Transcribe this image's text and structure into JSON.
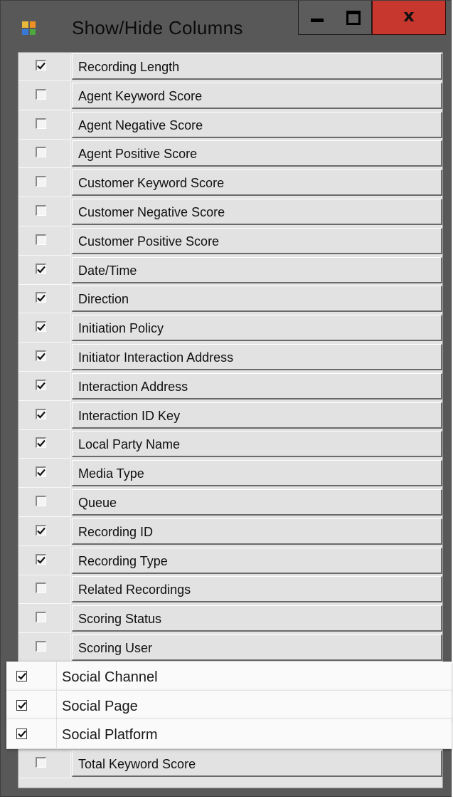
{
  "window": {
    "title": "Show/Hide Columns",
    "icon": "app-window-icon",
    "close_label": "x"
  },
  "columns": [
    {
      "label": "Recording Length",
      "checked": true
    },
    {
      "label": "Agent Keyword Score",
      "checked": false
    },
    {
      "label": "Agent Negative Score",
      "checked": false
    },
    {
      "label": "Agent Positive Score",
      "checked": false
    },
    {
      "label": "Customer Keyword Score",
      "checked": false
    },
    {
      "label": "Customer Negative Score",
      "checked": false
    },
    {
      "label": "Customer Positive Score",
      "checked": false
    },
    {
      "label": "Date/Time",
      "checked": true
    },
    {
      "label": "Direction",
      "checked": true
    },
    {
      "label": "Initiation Policy",
      "checked": true
    },
    {
      "label": "Initiator Interaction Address",
      "checked": true
    },
    {
      "label": "Interaction Address",
      "checked": true
    },
    {
      "label": "Interaction ID Key",
      "checked": true
    },
    {
      "label": "Local Party Name",
      "checked": true
    },
    {
      "label": "Media Type",
      "checked": true
    },
    {
      "label": "Queue",
      "checked": false
    },
    {
      "label": "Recording ID",
      "checked": true
    },
    {
      "label": "Recording Type",
      "checked": true
    },
    {
      "label": "Related Recordings",
      "checked": false
    },
    {
      "label": "Scoring Status",
      "checked": false
    },
    {
      "label": "Scoring User",
      "checked": false
    },
    {
      "label": "Social Channel",
      "checked": true,
      "highlighted": true
    },
    {
      "label": "Social Page",
      "checked": true,
      "highlighted": true
    },
    {
      "label": "Social Platform",
      "checked": true,
      "highlighted": true
    },
    {
      "label": "Total Keyword Score",
      "checked": false
    }
  ],
  "colors": {
    "close_button": "#c7372e",
    "frame": "#585858",
    "list_background": "#e3e3e3",
    "highlight_background": "#fafafa"
  }
}
